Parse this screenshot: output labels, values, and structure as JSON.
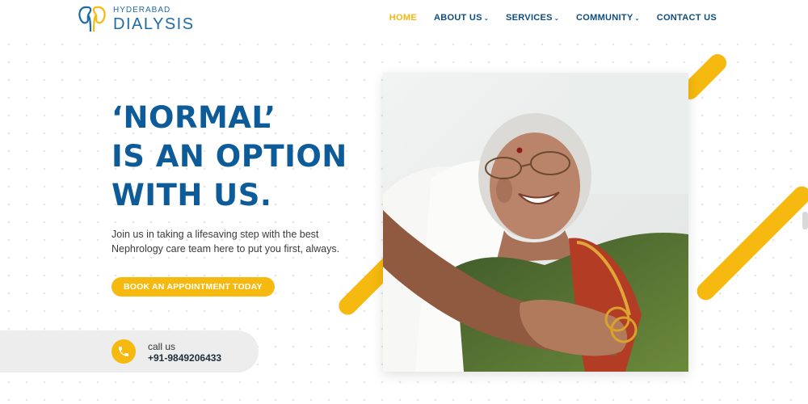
{
  "brand": {
    "logo_top": "HYDERABAD",
    "logo_bottom": "DIALYSIS",
    "logo_icon": "kidneys-icon",
    "primary_color": "#0d5b98",
    "accent_color": "#f6b90f"
  },
  "nav": {
    "items": [
      {
        "label": "HOME",
        "active": true,
        "has_dropdown": false
      },
      {
        "label": "ABOUT US",
        "active": false,
        "has_dropdown": true
      },
      {
        "label": "SERVICES",
        "active": false,
        "has_dropdown": true
      },
      {
        "label": "COMMUNITY",
        "active": false,
        "has_dropdown": true
      },
      {
        "label": "CONTACT US",
        "active": false,
        "has_dropdown": false
      }
    ],
    "dropdown_glyph": "⌄"
  },
  "hero": {
    "line1": "‘NORMAL’",
    "line2": "IS AN OPTION",
    "line3": "WITH US.",
    "tagline": "Join us in taking a lifesaving step with the best Nephrology care team here to put you first, always.",
    "cta_label": "BOOK AN APPOINTMENT TODAY"
  },
  "call": {
    "label": "call us",
    "number": "+91-9849206433",
    "icon": "phone-icon"
  },
  "photo": {
    "icon": "elderly-woman-smiling-photo"
  }
}
